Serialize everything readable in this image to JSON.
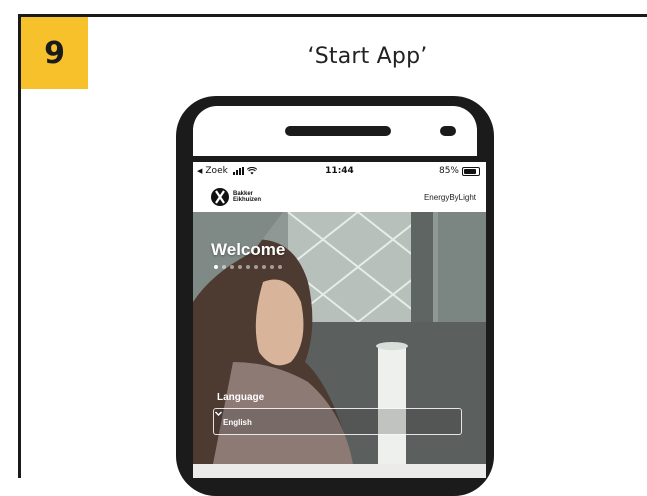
{
  "step": {
    "number": "9",
    "title": "‘Start App’"
  },
  "status_bar": {
    "back_label": "Zoek",
    "time": "11:44",
    "battery": "85%",
    "battery_level": 0.85
  },
  "header": {
    "brand_line1": "Bakker",
    "brand_line2": "Eikhuizen",
    "right_text": "EnergyByLight"
  },
  "hero": {
    "title": "Welcome",
    "slide_count": 9,
    "active_slide": 0
  },
  "language": {
    "label": "Language",
    "selected": "English"
  },
  "colors": {
    "badge": "#f6c12b",
    "frame": "#1a1a1a",
    "phone": "#1b1b1b"
  }
}
